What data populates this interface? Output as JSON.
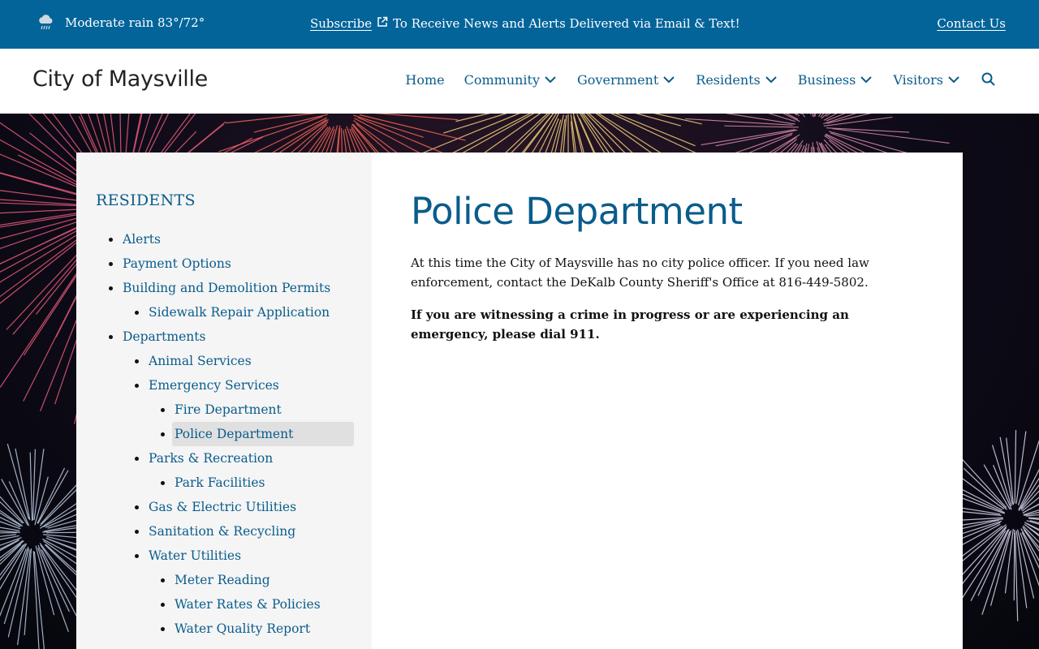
{
  "alert_bar": {
    "weather_icon": "rain-cloud-icon",
    "weather_text": "Moderate rain 83°/72°",
    "subscribe_label": "Subscribe",
    "subscribe_icon": "external-link-icon",
    "subscribe_text": "To Receive News and Alerts Delivered via Email & Text!",
    "contact_label": "Contact Us"
  },
  "header": {
    "site_title": "City of Maysville",
    "nav": [
      {
        "label": "Home",
        "dropdown": false
      },
      {
        "label": "Community",
        "dropdown": true
      },
      {
        "label": "Government",
        "dropdown": true
      },
      {
        "label": "Residents",
        "dropdown": true
      },
      {
        "label": "Business",
        "dropdown": true
      },
      {
        "label": "Visitors",
        "dropdown": true
      }
    ],
    "search_icon": "search-icon"
  },
  "sidebar": {
    "heading": "RESIDENTS",
    "items": [
      {
        "label": "Alerts",
        "level": 1
      },
      {
        "label": "Payment Options",
        "level": 1
      },
      {
        "label": "Building and Demolition Permits",
        "level": 1
      },
      {
        "label": "Sidewalk Repair Application",
        "level": 2
      },
      {
        "label": "Departments",
        "level": 1
      },
      {
        "label": "Animal Services",
        "level": 2
      },
      {
        "label": "Emergency Services",
        "level": 2
      },
      {
        "label": "Fire Department",
        "level": 3
      },
      {
        "label": "Police Department",
        "level": 3,
        "active": true
      },
      {
        "label": "Parks & Recreation",
        "level": 2
      },
      {
        "label": "Park Facilities",
        "level": 3
      },
      {
        "label": "Gas & Electric Utilities",
        "level": 2
      },
      {
        "label": "Sanitation & Recycling",
        "level": 2
      },
      {
        "label": "Water Utilities",
        "level": 2
      },
      {
        "label": "Meter Reading",
        "level": 3
      },
      {
        "label": "Water Rates & Policies",
        "level": 3
      },
      {
        "label": "Water Quality Report",
        "level": 3
      }
    ]
  },
  "main": {
    "title": "Police Department",
    "paragraph1": "At this time the City of Maysville has no city police officer. If you need law enforcement, contact the DeKalb County Sheriff's Office at 816-449-5802.",
    "paragraph2": "If you are witnessing a crime in progress or are experiencing an emergency, please dial 911."
  },
  "colors": {
    "alert_bar_bg": "#03649a",
    "link": "#0a5c8c",
    "sidebar_bg": "#f5f5f5",
    "active_item_bg": "#e0e0e0"
  }
}
